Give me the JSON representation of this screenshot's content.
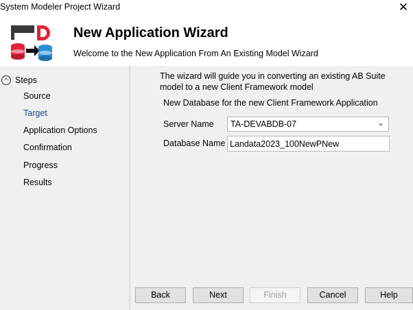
{
  "window": {
    "title": "System Modeler Project Wizard",
    "close_glyph": "✕"
  },
  "header": {
    "title": "New Application Wizard",
    "subtitle": "Welcome to the New Application From An Existing Model Wizard",
    "logo_icon": "database-convert-icon"
  },
  "sidebar": {
    "steps_label": "Steps",
    "toggle_glyph": "^",
    "items": [
      {
        "label": "Source",
        "active": false
      },
      {
        "label": "Target",
        "active": true
      },
      {
        "label": "Application Options",
        "active": false
      },
      {
        "label": "Confirmation",
        "active": false
      },
      {
        "label": "Progress",
        "active": false
      },
      {
        "label": "Results",
        "active": false
      }
    ]
  },
  "main": {
    "intro": "The wizard will guide you in converting an existing AB Suite model to a new Client Framework model",
    "section_title": "New Database for the new Client Framework Application",
    "server_label": "Server Name",
    "server_value": "TA-DEVABDB-07",
    "database_label": "Database Name",
    "database_value": "Landata2023_100NewPNew"
  },
  "buttons": {
    "back": "Back",
    "next": "Next",
    "finish": "Finish",
    "cancel": "Cancel",
    "help": "Help"
  }
}
